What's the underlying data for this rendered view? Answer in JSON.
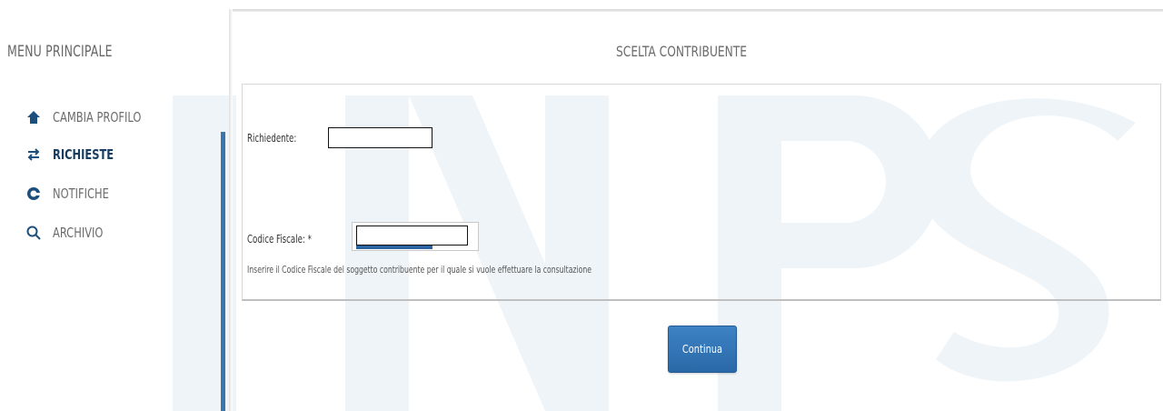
{
  "sidebar": {
    "title": "MENU PRINCIPALE",
    "items": [
      {
        "label": "CAMBIA PROFILO",
        "icon": "home-icon",
        "active": false
      },
      {
        "label": "RICHIESTE",
        "icon": "swap-arrows-icon",
        "active": true
      },
      {
        "label": "NOTIFICHE",
        "icon": "bell-icon",
        "active": false
      },
      {
        "label": "ARCHIVIO",
        "icon": "search-icon",
        "active": false
      }
    ]
  },
  "main": {
    "title": "SCELTA CONTRIBUENTE",
    "richiedente_label": "Richiedente:",
    "richiedente_value": "",
    "codice_fiscale_label": "Codice Fiscale: *",
    "codice_fiscale_value": "",
    "hint": "Inserire il Codice Fiscale del soggetto contribuente per il quale si vuole effettuare la consultazione",
    "continue_label": "Continua"
  },
  "colors": {
    "accent": "#2a69a8",
    "active_menu": "#163d61",
    "sidebar_bar": "#3b76ad"
  }
}
